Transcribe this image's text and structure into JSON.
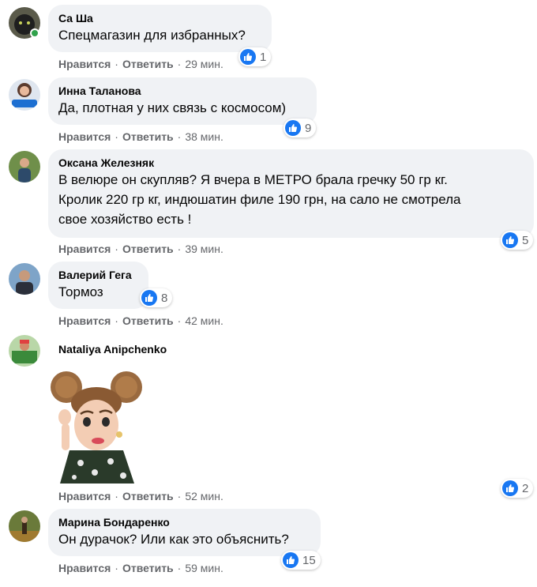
{
  "actions": {
    "like": "Нравится",
    "reply": "Ответить"
  },
  "comments": [
    {
      "author": "Са Ша",
      "text": "Спецмагазин для избранных?",
      "time": "29 мин.",
      "likes": "1",
      "online": true
    },
    {
      "author": "Инна Таланова",
      "text": "Да, плотная у них связь с космосом)",
      "time": "38 мин.",
      "likes": "9"
    },
    {
      "author": "Оксана Железняк",
      "text_lines": [
        "В велюре он скупляв? Я вчера в МЕТРО брала гречку 50 гр кг.",
        "Кролик 220 гр кг, индюшатин филе 190 грн, на сало не смотрела",
        "свое хозяйство есть !"
      ],
      "time": "39 мин.",
      "likes": "5"
    },
    {
      "author": "Валерий Гега",
      "text": "Тормоз",
      "time": "42 мин.",
      "likes": "8"
    },
    {
      "author": "Nataliya Anipchenko",
      "time": "52 мин.",
      "likes": "2",
      "sticker": "thinking-girl-sticker"
    },
    {
      "author": "Марина Бондаренко",
      "text": "Он дурачок? Или как это объяснить?",
      "time": "59 мин.",
      "likes": "15"
    }
  ]
}
